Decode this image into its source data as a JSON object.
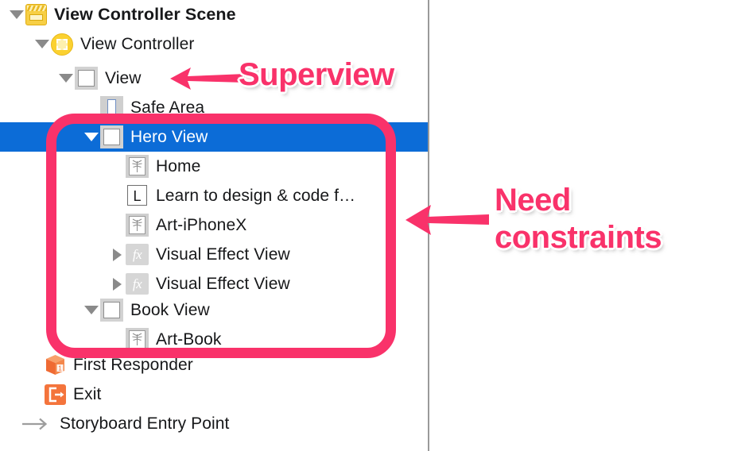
{
  "colors": {
    "annotation_pink": "#f9326a",
    "selection_blue": "#0c6cd7",
    "scene_yellow": "#f7cf45",
    "vc_yellow": "#fbd130",
    "exit_orange": "#f4743c",
    "text": "#17181a",
    "divider_gray": "#9a9a9a"
  },
  "outline": {
    "rows": [
      {
        "label": "View Controller Scene",
        "icon": "scene-icon",
        "disclosure": "open",
        "indent": 0,
        "selected": false,
        "bold": true
      },
      {
        "label": "View Controller",
        "icon": "view-controller-icon",
        "disclosure": "open",
        "indent": 1,
        "selected": false,
        "bold": false
      },
      {
        "label": "View",
        "icon": "view-icon",
        "disclosure": "open",
        "indent": 2,
        "selected": false,
        "bold": false
      },
      {
        "label": "Safe Area",
        "icon": "safe-area-icon",
        "disclosure": "none",
        "indent": 3,
        "selected": false,
        "bold": false
      },
      {
        "label": "Hero View",
        "icon": "view-icon",
        "disclosure": "open",
        "indent": 3,
        "selected": true,
        "bold": false
      },
      {
        "label": "Home",
        "icon": "image-view-icon",
        "disclosure": "none",
        "indent": 4,
        "selected": false,
        "bold": false
      },
      {
        "label": "Learn to design & code f…",
        "icon": "label-icon",
        "disclosure": "none",
        "indent": 4,
        "selected": false,
        "bold": false
      },
      {
        "label": "Art-iPhoneX",
        "icon": "image-view-icon",
        "disclosure": "none",
        "indent": 4,
        "selected": false,
        "bold": false
      },
      {
        "label": "Visual Effect View",
        "icon": "visual-effect-icon",
        "disclosure": "closed",
        "indent": 4,
        "selected": false,
        "bold": false
      },
      {
        "label": "Visual Effect View",
        "icon": "visual-effect-icon",
        "disclosure": "closed",
        "indent": 4,
        "selected": false,
        "bold": false
      },
      {
        "label": "Book View",
        "icon": "view-icon",
        "disclosure": "open",
        "indent": 3,
        "selected": false,
        "bold": false
      },
      {
        "label": "Art-Book",
        "icon": "image-view-icon",
        "disclosure": "none",
        "indent": 4,
        "selected": false,
        "bold": false
      },
      {
        "label": "First Responder",
        "icon": "first-responder-icon",
        "disclosure": "none",
        "indent": 0,
        "selected": false,
        "bold": false
      },
      {
        "label": "Exit",
        "icon": "exit-icon",
        "disclosure": "none",
        "indent": 0,
        "selected": false,
        "bold": false
      },
      {
        "label": "Storyboard Entry Point",
        "icon": "entry-point-arrow-icon",
        "disclosure": "none",
        "indent": 0,
        "selected": false,
        "bold": false
      }
    ]
  },
  "annotations": {
    "superview": "Superview",
    "need_constraints_line1": "Need",
    "need_constraints_line2": "constraints"
  }
}
